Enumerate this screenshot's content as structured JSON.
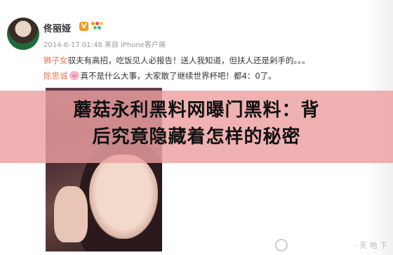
{
  "post": {
    "username": "佟丽娅",
    "vip_badge": "V",
    "timestamp": "2014-6-17 01:48",
    "source": "来自 iPhone客户端"
  },
  "comments": [
    {
      "user": "狮子女",
      "text": "驭夫有高招，吃饭见人必报告！送人我知道，但扶人还是剁手的。。。"
    },
    {
      "user": "陈思诚",
      "emoji": "pig-icon",
      "text": "真不是什么大事，大家散了继续世界杯吧！都4：0了。"
    }
  ],
  "banner": {
    "title_line1": "蘑菇永利黑料网曝门黑料：背",
    "title_line2": "后究竟隐藏着怎样的秘密"
  },
  "watermark": "· 天 地 下",
  "colors": {
    "accent": "#eb7350",
    "banner": "#eca0a0",
    "vip": "#f39a1c"
  }
}
